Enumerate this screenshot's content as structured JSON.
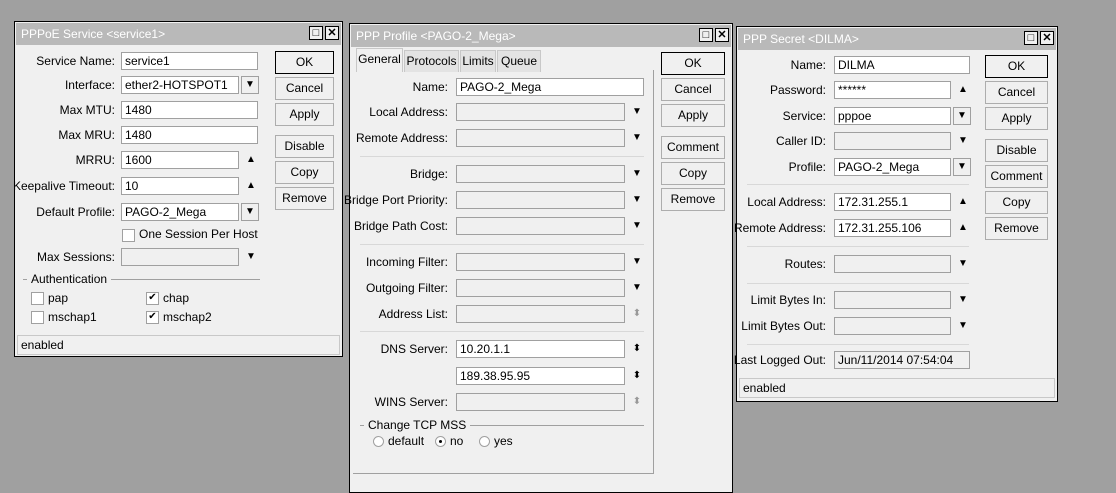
{
  "colors": {
    "desktop": "#a0a0a0",
    "window": "#f0f0f0",
    "titlebar": "#b9b9b9"
  },
  "windows": [
    {
      "title": "PPPoE Service <service1>",
      "fields": [
        {
          "label": "Service Name:",
          "value": "service1"
        },
        {
          "label": "Interface:",
          "value": "ether2-HOTSPOT1"
        },
        {
          "label": "Max MTU:",
          "value": "1480"
        },
        {
          "label": "Max MRU:",
          "value": "1480"
        },
        {
          "label": "MRRU:",
          "value": "1600"
        },
        {
          "label": "Keepalive Timeout:",
          "value": "10"
        },
        {
          "label": "Default Profile:",
          "value": "PAGO-2_Mega"
        },
        {
          "label": "Max Sessions:",
          "value": ""
        }
      ],
      "one_session": {
        "label": "One Session Per Host",
        "checked": false
      },
      "auth_group": "Authentication",
      "auth": [
        {
          "label": "pap",
          "checked": false
        },
        {
          "label": "chap",
          "checked": true
        },
        {
          "label": "mschap1",
          "checked": false
        },
        {
          "label": "mschap2",
          "checked": true
        }
      ],
      "buttons": [
        "OK",
        "Cancel",
        "Apply",
        "Disable",
        "Copy",
        "Remove"
      ],
      "status": "enabled"
    },
    {
      "title": "PPP Profile <PAGO-2_Mega>",
      "tabs": [
        "General",
        "Protocols",
        "Limits",
        "Queue"
      ],
      "active_tab": "General",
      "fields": [
        {
          "label": "Name:",
          "value": "PAGO-2_Mega"
        },
        {
          "label": "Local Address:",
          "value": ""
        },
        {
          "label": "Remote Address:",
          "value": ""
        },
        {
          "label": "Bridge:",
          "value": ""
        },
        {
          "label": "Bridge Port Priority:",
          "value": ""
        },
        {
          "label": "Bridge Path Cost:",
          "value": ""
        },
        {
          "label": "Incoming Filter:",
          "value": ""
        },
        {
          "label": "Outgoing Filter:",
          "value": ""
        },
        {
          "label": "Address List:",
          "value": ""
        },
        {
          "label": "DNS Server:",
          "value": "10.20.1.1"
        },
        {
          "label": "",
          "value": "189.38.95.95"
        },
        {
          "label": "WINS Server:",
          "value": ""
        }
      ],
      "tcp_mss_group": "Change TCP MSS",
      "tcp_mss": [
        {
          "label": "default"
        },
        {
          "label": "no"
        },
        {
          "label": "yes"
        }
      ],
      "tcp_mss_selected": "no",
      "buttons": [
        "OK",
        "Cancel",
        "Apply",
        "Comment",
        "Copy",
        "Remove"
      ]
    },
    {
      "title": "PPP Secret <DILMA>",
      "fields": [
        {
          "label": "Name:",
          "value": "DILMA"
        },
        {
          "label": "Password:",
          "value": "******"
        },
        {
          "label": "Service:",
          "value": "pppoe"
        },
        {
          "label": "Caller ID:",
          "value": ""
        },
        {
          "label": "Profile:",
          "value": "PAGO-2_Mega"
        },
        {
          "label": "Local Address:",
          "value": "172.31.255.1"
        },
        {
          "label": "Remote Address:",
          "value": "172.31.255.106"
        },
        {
          "label": "Routes:",
          "value": ""
        },
        {
          "label": "Limit Bytes In:",
          "value": ""
        },
        {
          "label": "Limit Bytes Out:",
          "value": ""
        },
        {
          "label": "Last Logged Out:",
          "value": "Jun/11/2014 07:54:04"
        }
      ],
      "buttons": [
        "OK",
        "Cancel",
        "Apply",
        "Disable",
        "Comment",
        "Copy",
        "Remove"
      ],
      "status": "enabled"
    }
  ]
}
